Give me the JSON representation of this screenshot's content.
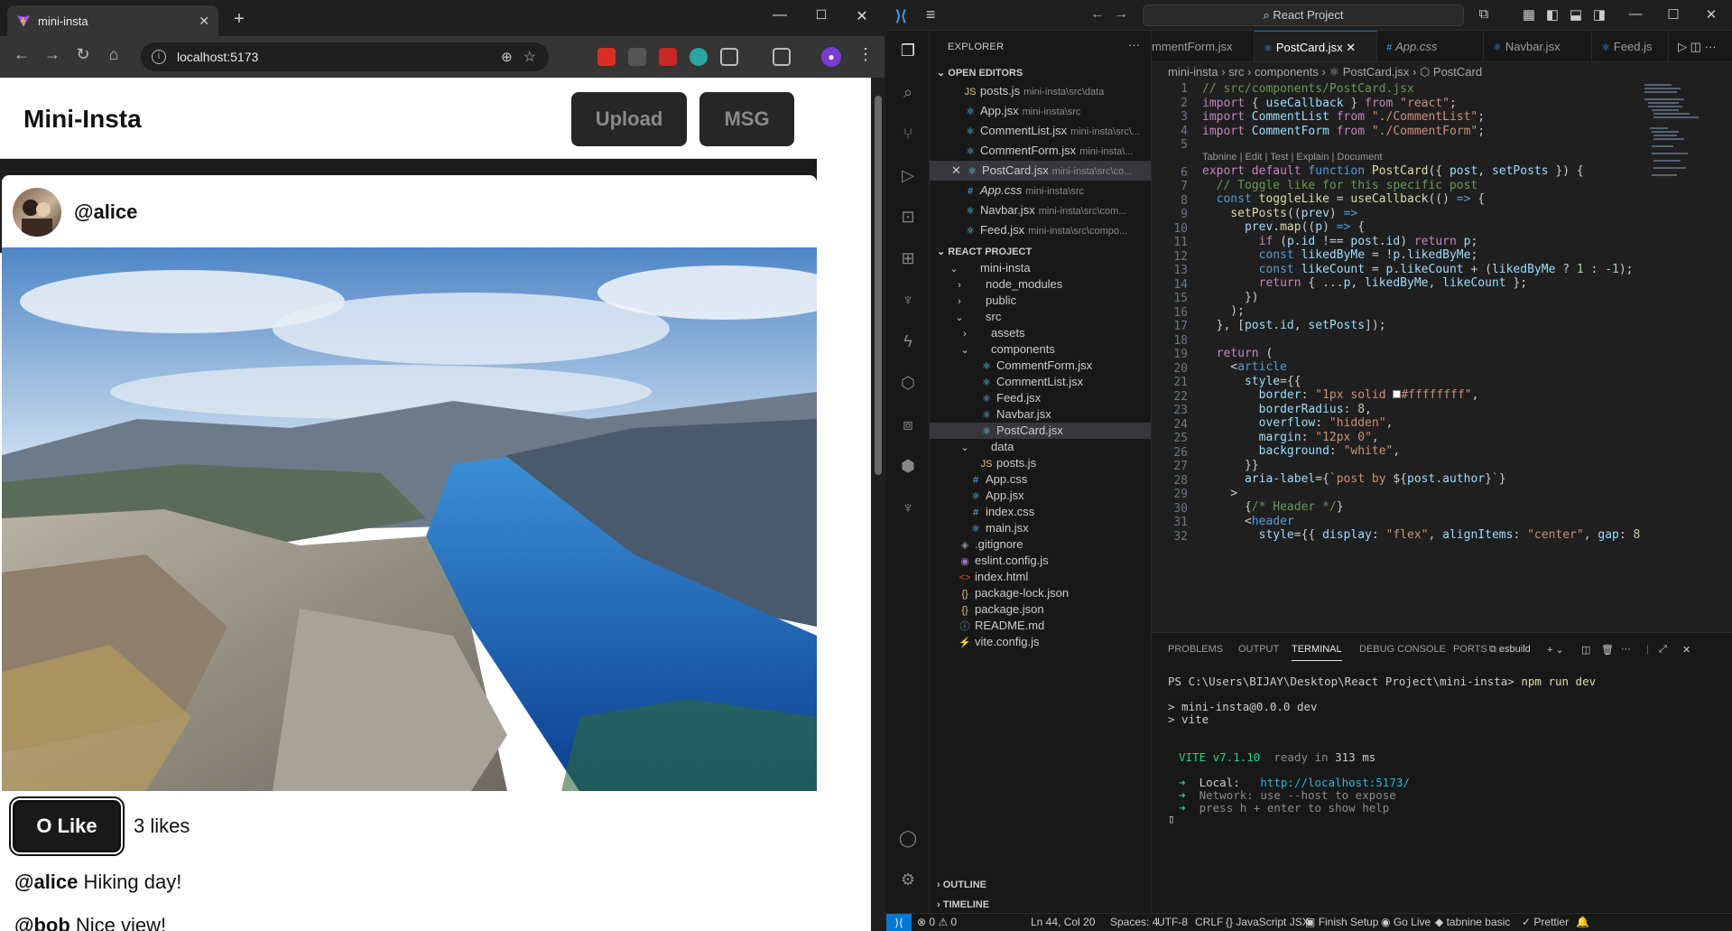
{
  "browser": {
    "tab_title": "mini-insta",
    "url": "localhost:5173"
  },
  "app": {
    "brand": "Mini-Insta",
    "upload_label": "Upload",
    "msg_label": "MSG",
    "post": {
      "author": "@alice",
      "like_label": "O Like",
      "likes_text": "3 likes",
      "comments": [
        {
          "user": "@alice",
          "text": "Hiking day!"
        },
        {
          "user": "@bob",
          "text": "Nice view!"
        }
      ]
    }
  },
  "vscode": {
    "search_text": "React Project",
    "explorer_title": "EXPLORER",
    "open_editors_title": "OPEN EDITORS",
    "open_editors": [
      {
        "icon": "JS",
        "name": "posts.js",
        "desc": "mini-insta\\src\\data"
      },
      {
        "icon": "⚛",
        "name": "App.jsx",
        "desc": "mini-insta\\src"
      },
      {
        "icon": "⚛",
        "name": "CommentList.jsx",
        "desc": "mini-insta\\src\\..."
      },
      {
        "icon": "⚛",
        "name": "CommentForm.jsx",
        "desc": "mini-insta\\..."
      },
      {
        "icon": "⚛",
        "name": "PostCard.jsx",
        "desc": "mini-insta\\src\\co..."
      },
      {
        "icon": "#",
        "name": "App.css",
        "desc": "mini-insta\\src"
      },
      {
        "icon": "⚛",
        "name": "Navbar.jsx",
        "desc": "mini-insta\\src\\com..."
      },
      {
        "icon": "⚛",
        "name": "Feed.jsx",
        "desc": "mini-insta\\src\\compo..."
      }
    ],
    "project_title": "REACT PROJECT",
    "tree": [
      {
        "chev": "⌄",
        "icon": "",
        "name": "mini-insta"
      },
      {
        "chev": "›",
        "icon": "",
        "name": "node_modules"
      },
      {
        "chev": "›",
        "icon": "",
        "name": "public"
      },
      {
        "chev": "⌄",
        "icon": "",
        "name": "src"
      },
      {
        "chev": "›",
        "icon": "",
        "name": "assets"
      },
      {
        "chev": "⌄",
        "icon": "",
        "name": "components"
      },
      {
        "chev": "",
        "icon": "⚛",
        "name": "CommentForm.jsx"
      },
      {
        "chev": "",
        "icon": "⚛",
        "name": "CommentList.jsx"
      },
      {
        "chev": "",
        "icon": "⚛",
        "name": "Feed.jsx"
      },
      {
        "chev": "",
        "icon": "⚛",
        "name": "Navbar.jsx"
      },
      {
        "chev": "",
        "icon": "⚛",
        "name": "PostCard.jsx"
      },
      {
        "chev": "⌄",
        "icon": "",
        "name": "data"
      },
      {
        "chev": "",
        "icon": "JS",
        "name": "posts.js"
      },
      {
        "chev": "",
        "icon": "#",
        "name": "App.css"
      },
      {
        "chev": "",
        "icon": "⚛",
        "name": "App.jsx"
      },
      {
        "chev": "",
        "icon": "#",
        "name": "index.css"
      },
      {
        "chev": "",
        "icon": "⚛",
        "name": "main.jsx"
      },
      {
        "chev": "",
        "icon": "◈",
        "name": ".gitignore"
      },
      {
        "chev": "",
        "icon": "◉",
        "name": "eslint.config.js"
      },
      {
        "chev": "",
        "icon": "<>",
        "name": "index.html"
      },
      {
        "chev": "",
        "icon": "{}",
        "name": "package-lock.json"
      },
      {
        "chev": "",
        "icon": "{}",
        "name": "package.json"
      },
      {
        "chev": "",
        "icon": "ⓘ",
        "name": "README.md"
      },
      {
        "chev": "",
        "icon": "⚡",
        "name": "vite.config.js"
      }
    ],
    "outline_title": "OUTLINE",
    "timeline_title": "TIMELINE",
    "tabs": [
      "mmentForm.jsx",
      "PostCard.jsx",
      "App.css",
      "Navbar.jsx",
      "Feed.js"
    ],
    "breadcrumb": "mini-insta  ›  src  ›  components  ›  ⚛ PostCard.jsx  ›  ⬡ PostCard",
    "codelens": "Tabnine | Edit | Test | Explain | Document",
    "panel_tabs": [
      "PROBLEMS",
      "OUTPUT",
      "TERMINAL",
      "DEBUG CONSOLE",
      "PORTS"
    ],
    "terminal_name": "esbuild",
    "terminal": {
      "prompt": "PS C:\\Users\\BIJAY\\Desktop\\React Project\\mini-insta>",
      "command": "npm run dev",
      "line1": "> mini-insta@0.0.0 dev",
      "line2": "> vite",
      "vite_name": "VITE v7.1.10",
      "ready_text": "ready in",
      "ready_ms": "313 ms",
      "local_label": "Local:",
      "local_url": "http://localhost:5173/",
      "network_line": "Network: use --host to expose",
      "help_line": "press h + enter to show help"
    },
    "status": {
      "problems": "⊗ 0 ⚠ 0",
      "position": "Ln 44, Col 20",
      "spaces": "Spaces: 4",
      "encoding": "UTF-8",
      "eol": "CRLF",
      "language": "{} JavaScript JSX",
      "finish_setup": "Finish Setup",
      "go_live": "Go Live",
      "tabnine": "tabnine basic",
      "prettier": "✓ Prettier"
    }
  }
}
